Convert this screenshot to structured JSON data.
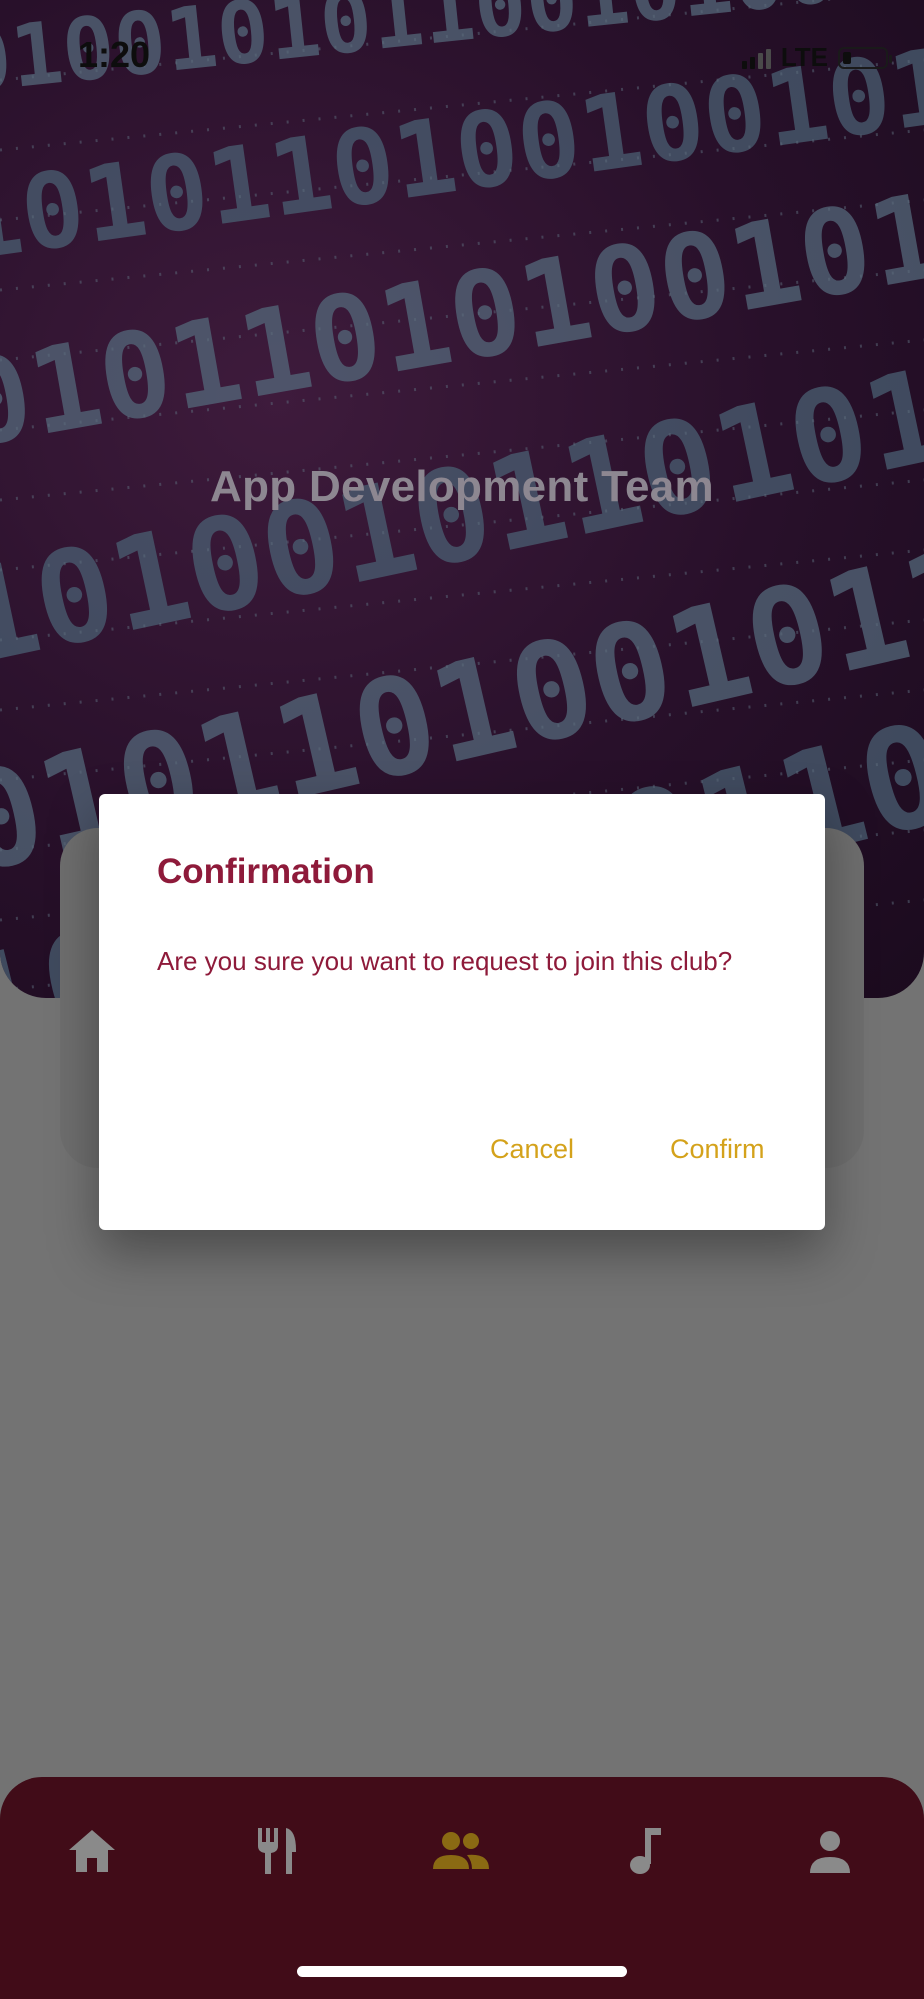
{
  "status_bar": {
    "time": "1:20",
    "network": "LTE"
  },
  "hero": {
    "title": "App Development Team"
  },
  "dialog": {
    "title": "Confirmation",
    "message": "Are you sure you want to request to join this club?",
    "cancel_label": "Cancel",
    "confirm_label": "Confirm"
  },
  "bottom_nav": {
    "items": [
      {
        "icon": "home-icon",
        "active": false
      },
      {
        "icon": "dining-icon",
        "active": false
      },
      {
        "icon": "clubs-icon",
        "active": true
      },
      {
        "icon": "music-icon",
        "active": false
      },
      {
        "icon": "profile-icon",
        "active": false
      }
    ]
  },
  "colors": {
    "brand_maroon": "#8e1a3a",
    "accent_gold": "#d4a21b",
    "nav_background": "#410c18",
    "nav_icon_inactive": "#8a8a8a",
    "nav_icon_active": "#8a6a13"
  }
}
